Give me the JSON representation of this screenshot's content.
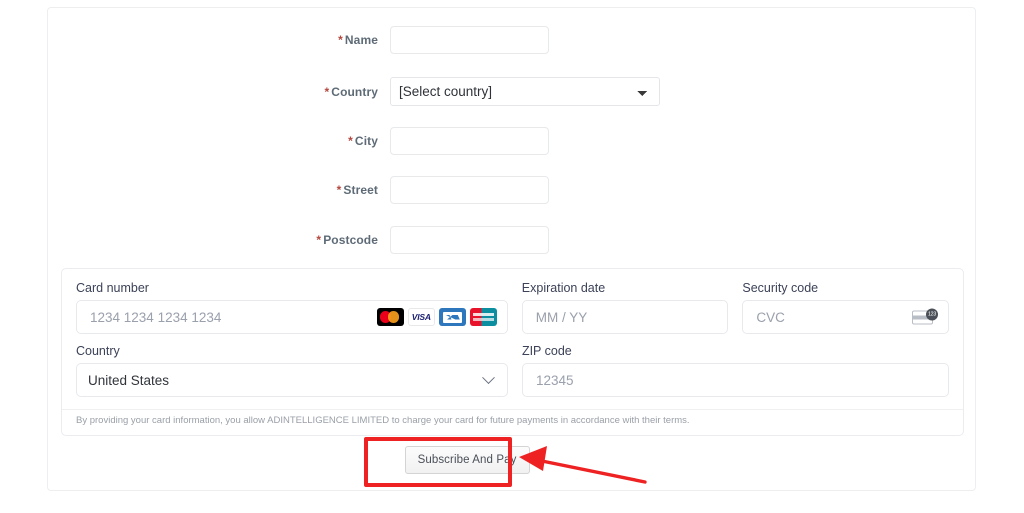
{
  "form": {
    "fields": [
      {
        "label": "Name",
        "required": true,
        "value": "",
        "placeholder": ""
      },
      {
        "label": "Country",
        "required": true,
        "value": "[Select country]",
        "placeholder": ""
      },
      {
        "label": "City",
        "required": true,
        "value": "",
        "placeholder": ""
      },
      {
        "label": "Street",
        "required": true,
        "value": "",
        "placeholder": ""
      },
      {
        "label": "Postcode",
        "required": true,
        "value": "",
        "placeholder": ""
      }
    ],
    "required_marker": "*",
    "country_options": [
      "[Select country]"
    ]
  },
  "card_section": {
    "card_number": {
      "label": "Card number",
      "placeholder": "1234 1234 1234 1234",
      "value": "",
      "brands": [
        "mastercard-icon",
        "visa-icon",
        "amex-icon",
        "discover-icon"
      ]
    },
    "expiration": {
      "label": "Expiration date",
      "placeholder": "MM / YY",
      "value": ""
    },
    "security_code": {
      "label": "Security code",
      "placeholder": "CVC",
      "value": "",
      "icon": "cvc-card-icon",
      "icon_text": "123"
    },
    "country": {
      "label": "Country",
      "value": "United States",
      "icon": "chevron-down-icon"
    },
    "zip": {
      "label": "ZIP code",
      "placeholder": "12345",
      "value": ""
    },
    "disclaimer": "By providing your card information, you allow ADINTELLIGENCE LIMITED to charge your card for future payments in accordance with their terms."
  },
  "actions": {
    "submit_label": "Subscribe And Pay"
  },
  "annotations": {
    "highlight_color": "#ee2222",
    "arrow": "left-pointing-arrow",
    "target": "submit-button"
  },
  "colors": {
    "required_asterisk": "#b5483f",
    "label_text": "#5e6b77",
    "card_label_text": "#3c4257",
    "placeholder": "#9aa0ac",
    "panel_border": "#eceef0",
    "annotation_red": "#ee2222"
  }
}
